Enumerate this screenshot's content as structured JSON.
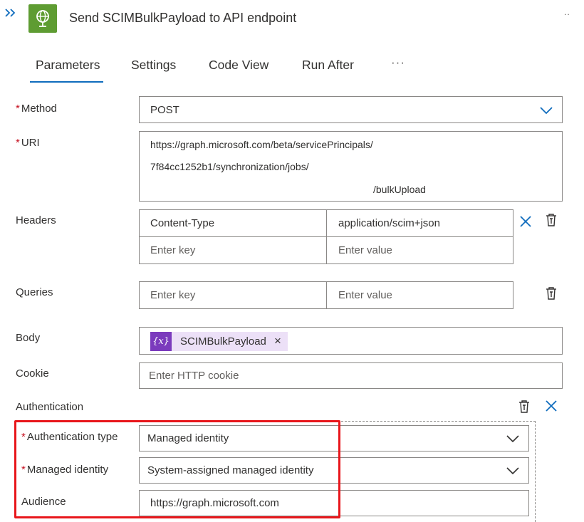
{
  "header": {
    "title": "Send SCIMBulkPayload to API endpoint",
    "more_label": ".."
  },
  "tabs": [
    {
      "label": "Parameters"
    },
    {
      "label": "Settings"
    },
    {
      "label": "Code View"
    },
    {
      "label": "Run After"
    }
  ],
  "tabs_more_label": "···",
  "required_marker": "*",
  "method": {
    "label": "Method",
    "value": "POST"
  },
  "uri": {
    "label": "URI",
    "lines": [
      "https://graph.microsoft.com/beta/servicePrincipals/",
      "7f84cc1252b1/synchronization/jobs/",
      "/bulkUpload"
    ]
  },
  "headers": {
    "label": "Headers",
    "rows": [
      {
        "key": "Content-Type",
        "value": "application/scim+json"
      }
    ],
    "key_placeholder": "Enter key",
    "value_placeholder": "Enter value"
  },
  "queries": {
    "label": "Queries",
    "key_placeholder": "Enter key",
    "value_placeholder": "Enter value"
  },
  "body": {
    "label": "Body",
    "token_icon": "{x}",
    "token_label": "SCIMBulkPayload",
    "token_remove": "×"
  },
  "cookie": {
    "label": "Cookie",
    "placeholder": "Enter HTTP cookie"
  },
  "authentication": {
    "label": "Authentication",
    "type_label": "Authentication type",
    "type_value": "Managed identity",
    "identity_label": "Managed identity",
    "identity_value": "System-assigned managed identity",
    "audience_label": "Audience",
    "audience_value": "https://graph.microsoft.com"
  },
  "colors": {
    "accent": "#0f6cbd",
    "step_icon": "#5e9c32",
    "token": "#7b3bbd",
    "token_bg": "#ece0f7",
    "highlight": "#e8161b",
    "required": "#c50f1f"
  },
  "icons": {
    "expand": "chevron-double-right-icon",
    "step": "globe-icon",
    "delete": "trash-icon",
    "remove": "close-icon",
    "dropdown": "chevron-down-icon"
  }
}
